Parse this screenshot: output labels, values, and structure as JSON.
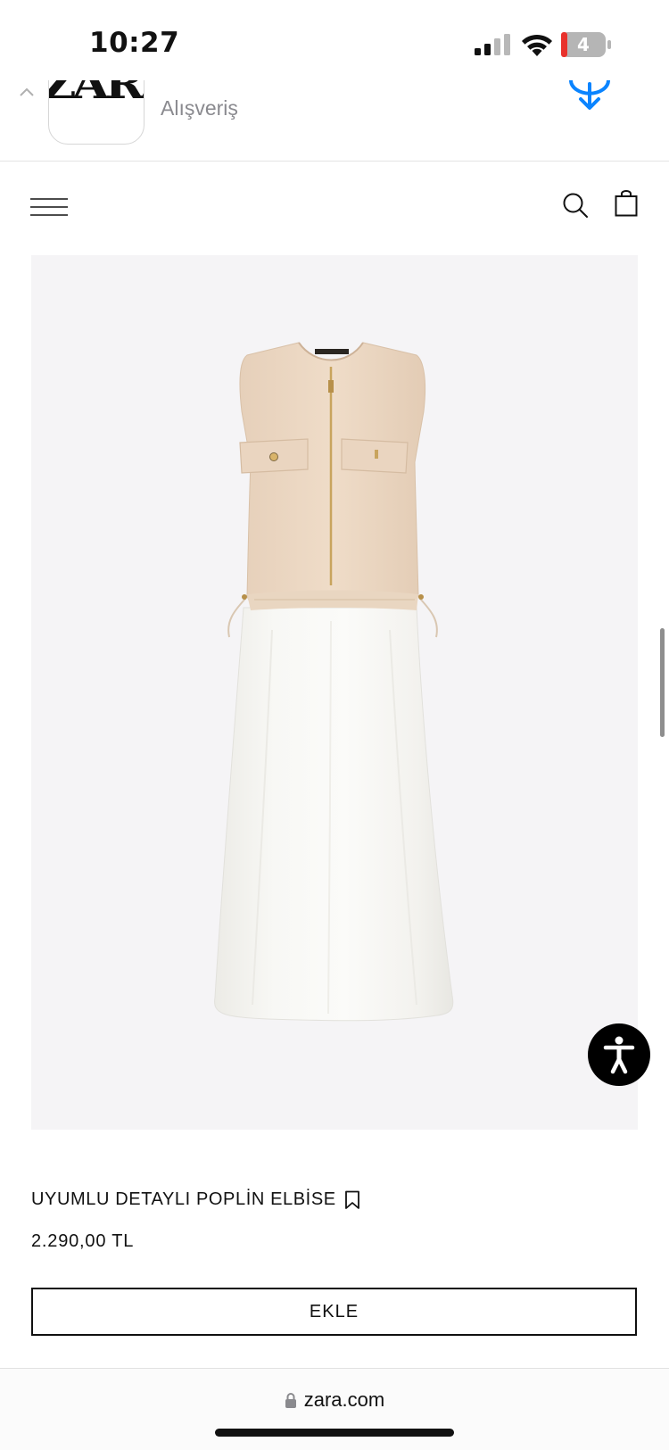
{
  "status_bar": {
    "time": "10:27",
    "battery_level": "4"
  },
  "app_banner": {
    "app_logo_text": "ZARA",
    "subtitle": "Alışveriş",
    "accent_color": "#0a84ff"
  },
  "header": {
    "menu_icon": "hamburger-menu-icon",
    "search_icon": "search-icon",
    "bag_icon": "shopping-bag-icon"
  },
  "product": {
    "name": "UYUMLU DETAYLI POPLİN ELBİSE",
    "price": "2.290,00 TL",
    "add_label": "EKLE",
    "image_background": "#f5f4f6"
  },
  "url_bar": {
    "domain": "zara.com"
  }
}
